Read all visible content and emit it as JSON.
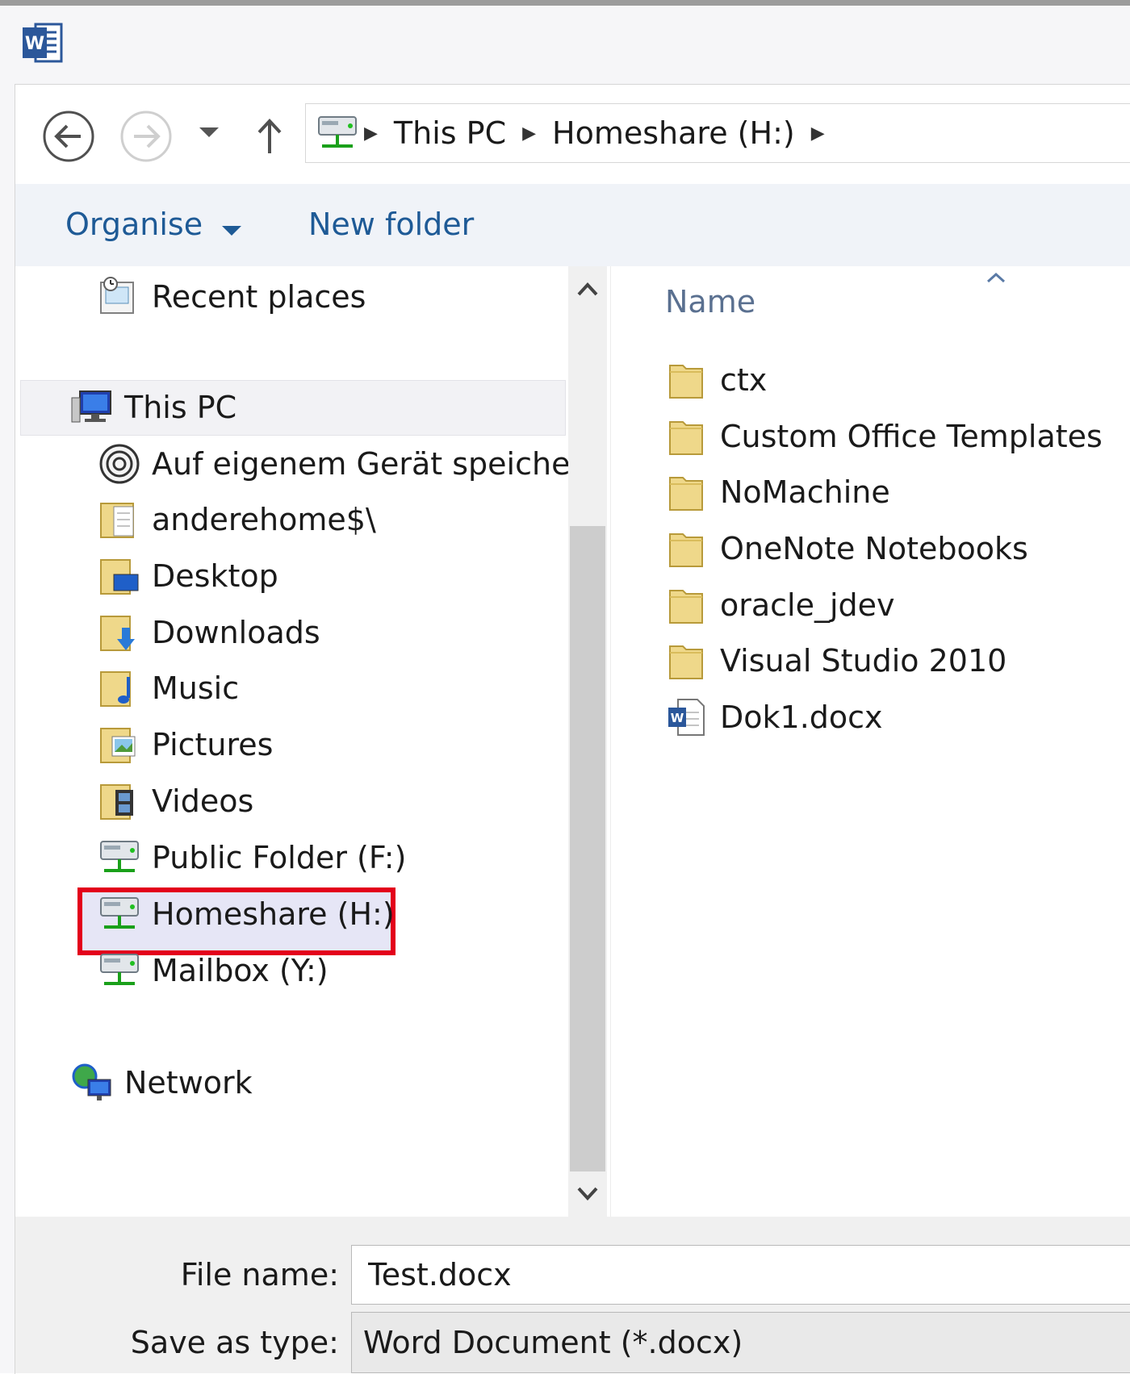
{
  "colors": {
    "accent_link": "#1e5a96",
    "highlight_border": "#e3001b",
    "selection_bg": "#e6e6f6"
  },
  "app": {
    "icon": "word-icon"
  },
  "nav_buttons": {
    "back": "back-arrow-icon",
    "forward": "forward-arrow-icon",
    "recent": "dropdown-chevron-icon",
    "up": "up-arrow-icon"
  },
  "address_bar": {
    "root_icon": "network-drive-icon",
    "segments": [
      "This PC",
      "Homeshare (H:)"
    ]
  },
  "toolbar": {
    "organise": "Organise",
    "new_folder": "New folder"
  },
  "nav_pane": {
    "recent_places": "Recent places",
    "this_pc": "This PC",
    "items": [
      {
        "label": "Auf eigenem Gerät speichern",
        "icon": "device-save-icon"
      },
      {
        "label": "anderehome$\\",
        "icon": "folder-doc-icon"
      },
      {
        "label": "Desktop",
        "icon": "desktop-folder-icon"
      },
      {
        "label": "Downloads",
        "icon": "downloads-folder-icon"
      },
      {
        "label": "Music",
        "icon": "music-folder-icon"
      },
      {
        "label": "Pictures",
        "icon": "pictures-folder-icon"
      },
      {
        "label": "Videos",
        "icon": "videos-folder-icon"
      },
      {
        "label": "Public Folder (F:)",
        "icon": "network-drive-icon"
      },
      {
        "label": "Homeshare (H:)",
        "icon": "network-drive-icon"
      },
      {
        "label": "Mailbox (Y:)",
        "icon": "network-drive-icon"
      }
    ],
    "network": "Network"
  },
  "file_list": {
    "column_name": "Name",
    "items": [
      {
        "name": "ctx",
        "type": "folder"
      },
      {
        "name": "Custom Office Templates",
        "type": "folder"
      },
      {
        "name": "NoMachine",
        "type": "folder"
      },
      {
        "name": "OneNote Notebooks",
        "type": "folder"
      },
      {
        "name": "oracle_jdev",
        "type": "folder"
      },
      {
        "name": "Visual Studio 2010",
        "type": "folder"
      },
      {
        "name": "Dok1.docx",
        "type": "word-document"
      }
    ]
  },
  "footer": {
    "file_name_label": "File name:",
    "file_name_value": "Test.docx",
    "save_type_label": "Save as type:",
    "save_type_value": "Word Document (*.docx)"
  }
}
